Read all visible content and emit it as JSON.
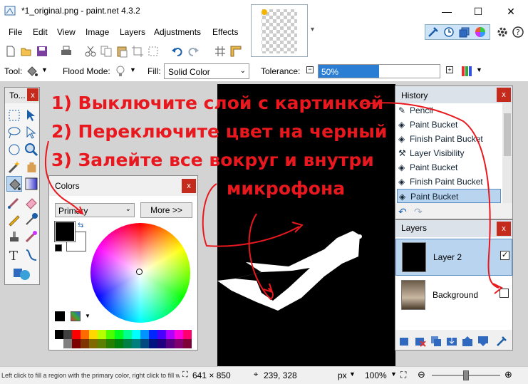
{
  "window": {
    "title": "*1_original.png - paint.net 4.3.2",
    "min": "—",
    "max": "☐",
    "close": "✕"
  },
  "menu": [
    "File",
    "Edit",
    "View",
    "Image",
    "Layers",
    "Adjustments",
    "Effects"
  ],
  "toolbar2": {
    "tool_label": "Tool:",
    "flood_label": "Flood Mode:",
    "fill_label": "Fill:",
    "fill_value": "Solid Color",
    "tolerance_label": "Tolerance:",
    "tolerance_value": "50%",
    "tolerance_fraction": 0.5
  },
  "tools_panel": {
    "title": "To..."
  },
  "colors_panel": {
    "title": "Colors",
    "close": "x",
    "mode": "Primary",
    "more_button": "More >>",
    "primary_color": "#000000",
    "secondary_color": "#ffffff"
  },
  "history_panel": {
    "title": "History",
    "close": "x",
    "items": [
      "Pencil",
      "Paint Bucket",
      "Finish Paint Bucket",
      "Layer Visibility",
      "Paint Bucket",
      "Finish Paint Bucket",
      "Paint Bucket"
    ],
    "selected_index": 6
  },
  "layers_panel": {
    "title": "Layers",
    "close": "x",
    "layers": [
      {
        "name": "Layer 2",
        "visible": true,
        "selected": true
      },
      {
        "name": "Background",
        "visible": false,
        "selected": false
      }
    ]
  },
  "annotations": {
    "line1": "1) Выключите слой с картинкой",
    "line2": "2) Переключите цвет на черный",
    "line3": "3) Залейте все вокруг и внутри",
    "line4": "микрофона"
  },
  "status": {
    "hint": "Left click to fill a region with the primary color, right click to fill with the s...",
    "image_size": "641 × 850",
    "cursor_pos": "239, 328",
    "units": "px",
    "zoom": "100%"
  }
}
